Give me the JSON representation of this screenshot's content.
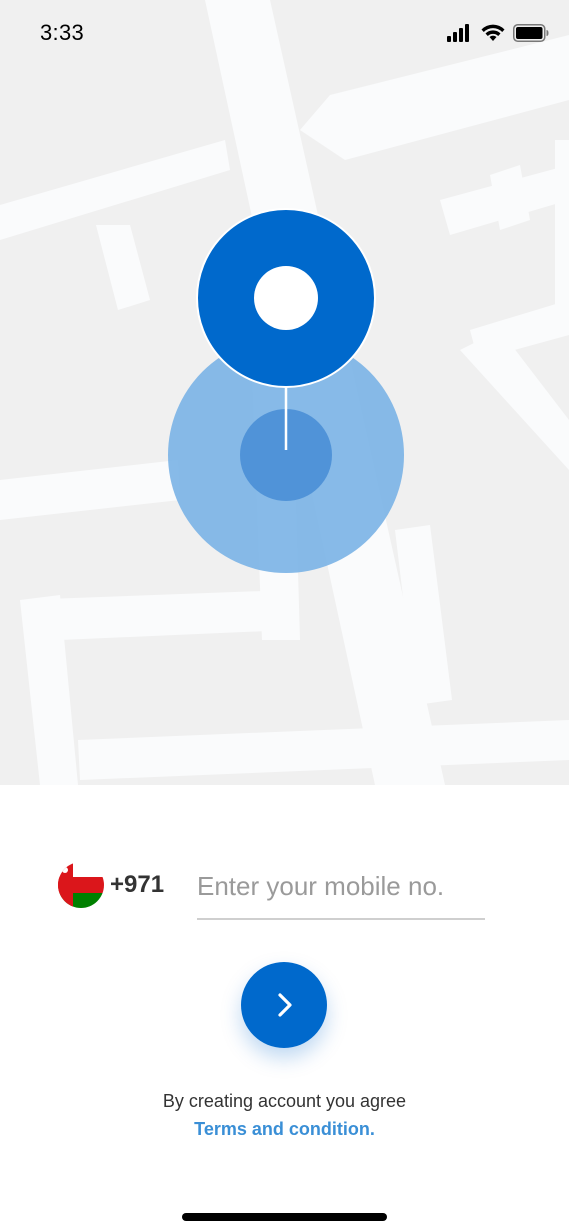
{
  "status_bar": {
    "time": "3:33",
    "icons": [
      "signal-icon",
      "wifi-icon",
      "battery-icon"
    ]
  },
  "map": {
    "background_color": "#f0f0f0",
    "road_color": "#fafbfc",
    "pin_icon": "location-pin-icon",
    "pin_color": "#0069cc",
    "accuracy_color": "#7ab3e6"
  },
  "login": {
    "flag_icon": "oman-flag-icon",
    "dial_code": "+971",
    "phone_value": "",
    "phone_placeholder": "Enter your mobile no.",
    "next_icon": "chevron-right-icon",
    "terms_text": "By creating account you agree",
    "terms_link": "Terms and condition."
  },
  "colors": {
    "primary": "#0069cc",
    "link": "#3a8fd6",
    "text": "#333333",
    "placeholder": "#9a9a9a"
  }
}
